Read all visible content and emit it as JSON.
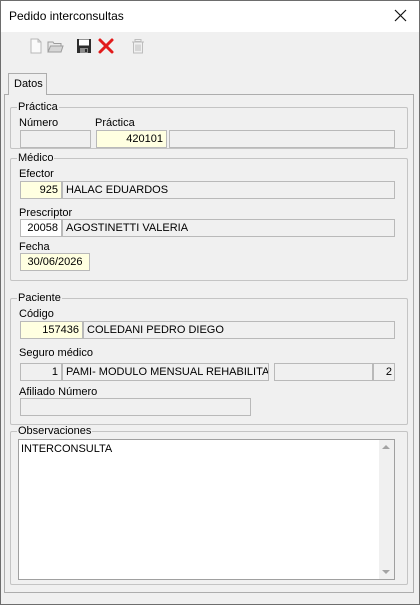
{
  "window": {
    "title": "Pedido interconsultas",
    "close_icon": "close-icon"
  },
  "toolbar": {
    "icons": [
      "new-document-icon",
      "open-folder-icon",
      "save-icon",
      "delete-x-icon",
      "trash-icon"
    ]
  },
  "tabs": [
    {
      "label": "Datos"
    }
  ],
  "practica": {
    "title": "Práctica",
    "numero_label": "Número",
    "numero_value": "",
    "practica_label": "Práctica",
    "practica_code": "420101",
    "practica_desc": ""
  },
  "medico": {
    "title": "Médico",
    "efector_label": "Efector",
    "efector_code": "925",
    "efector_name": "HALAC EDUARDOS",
    "prescriptor_label": "Prescriptor",
    "prescriptor_code": "20058",
    "prescriptor_name": "AGOSTINETTI VALERIA",
    "fecha_label": "Fecha",
    "fecha_value": "30/06/2026"
  },
  "paciente": {
    "title": "Paciente",
    "codigo_label": "Código",
    "codigo_value": "157436",
    "nombre": "COLEDANI PEDRO DIEGO",
    "seguro_label": "Seguro médico",
    "seguro_code": "1",
    "seguro_name": "PAMI- MODULO MENSUAL REHABILITA",
    "seguro_extra": "",
    "seguro_num": "2",
    "afiliado_label": "Afiliado Número",
    "afiliado_value": ""
  },
  "observaciones": {
    "title": "Observaciones",
    "text": "INTERCONSULTA"
  }
}
